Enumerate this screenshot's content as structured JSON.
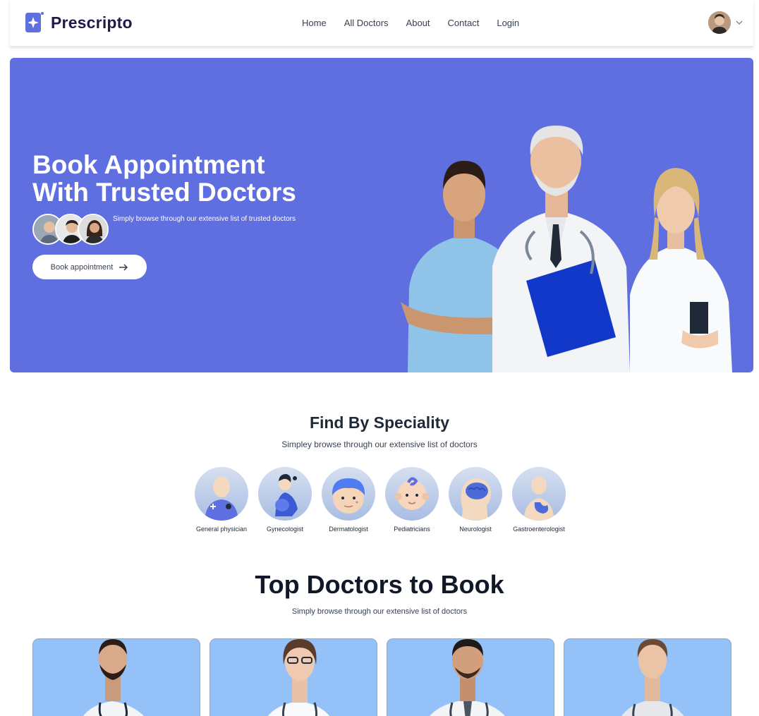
{
  "header": {
    "brand": "Prescripto",
    "nav": [
      "Home",
      "All Doctors",
      "About",
      "Contact",
      "Login"
    ]
  },
  "hero": {
    "title_line1": "Book Appointment",
    "title_line2": "With Trusted Doctors",
    "subtitle": "Simply browse through our extensive list of trusted doctors",
    "button": "Book appointment"
  },
  "speciality": {
    "title": "Find By Speciality",
    "subtitle": "Simpley browse through our extensive list of doctors",
    "items": [
      "General physician",
      "Gynecologist",
      "Dermatologist",
      "Pediatricians",
      "Neurologist",
      "Gastroenterologist"
    ]
  },
  "top_doctors": {
    "title": "Top Doctors to Book",
    "subtitle": "Simply browse through our extensive list of doctors"
  },
  "colors": {
    "primary": "#5f6fe0",
    "card_bg": "#94c1f8"
  }
}
